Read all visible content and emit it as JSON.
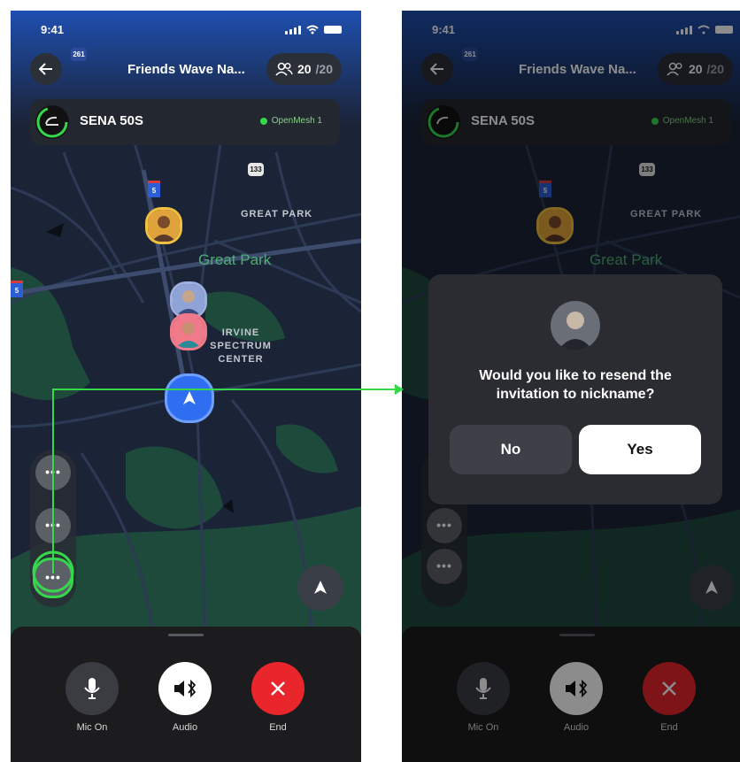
{
  "status": {
    "time": "9:41"
  },
  "header": {
    "title": "Friends Wave Na...",
    "members_current": "20",
    "members_total": "/20"
  },
  "device": {
    "name": "SENA 50S",
    "network": "OpenMesh 1"
  },
  "map": {
    "labels": {
      "great_park_upper": "GREAT PARK",
      "great_park": "Great Park",
      "irvine_1": "IRVINE",
      "irvine_2": "SPECTRUM",
      "irvine_3": "CENTER"
    },
    "routes": {
      "r261": "261",
      "r133": "133",
      "i5": "5",
      "i5_side": "5"
    }
  },
  "roster": {
    "more_label": "•••"
  },
  "controls": {
    "mic_label": "Mic On",
    "audio_label": "Audio",
    "end_label": "End"
  },
  "dialog": {
    "message": "Would you like to resend the invitation to nickname?",
    "no_label": "No",
    "yes_label": "Yes"
  },
  "colors": {
    "accent_green": "#35d84b",
    "accent_blue": "#2f6ef0",
    "end_red": "#e8262c"
  }
}
